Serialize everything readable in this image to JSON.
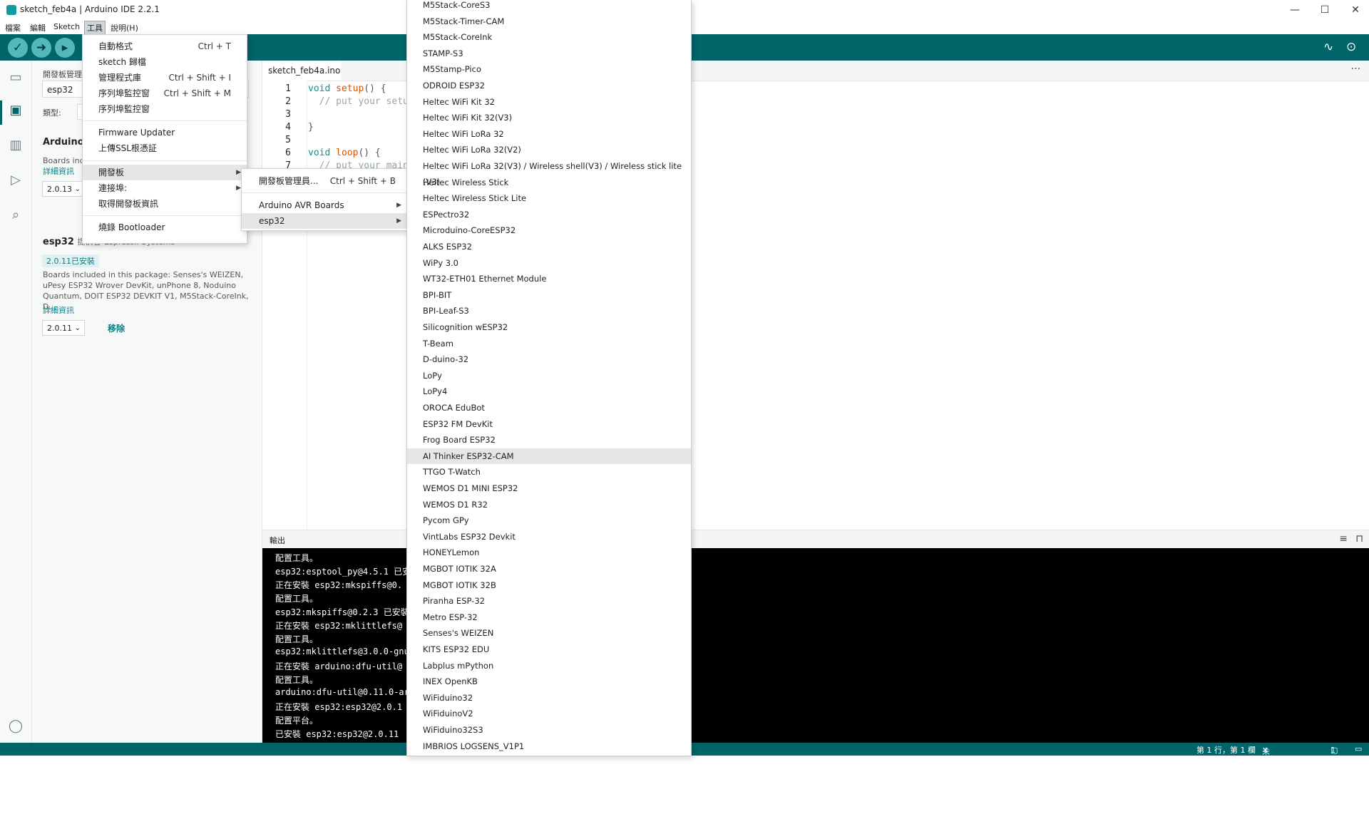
{
  "window": {
    "title": "sketch_feb4a | Arduino IDE 2.2.1",
    "minimize": "—",
    "maximize": "☐",
    "close": "✕"
  },
  "menubar": [
    "檔案",
    "編輯",
    "Sketch",
    "工具",
    "說明(H)"
  ],
  "side_panel": {
    "header": "開發板管理員",
    "search_value": "esp32",
    "type_label": "類型:",
    "boards": [
      {
        "name": "Arduino",
        "desc": "Boards inc",
        "link": "詳細資訊",
        "version": "2.0.13"
      },
      {
        "name": "esp32",
        "by": "提供者",
        "author": "Espressif Systems",
        "installed": "2.0.11已安裝",
        "desc": "Boards included in this package: Senses's WEIZEN, uPesy ESP32 Wrover DevKit, unPhone 8, Noduino Quantum, DOIT ESP32 DEVKIT V1, M5Stack-CoreInk, D...",
        "link": "詳細資訊",
        "version": "2.0.11",
        "remove": "移除"
      }
    ]
  },
  "editor": {
    "tab": "sketch_feb4a.ino",
    "line_numbers": [
      "1",
      "2",
      "3",
      "4",
      "5",
      "6",
      "7"
    ],
    "code": {
      "l1_kw": "void",
      "l1_fn": "setup",
      "l1_rest": "() {",
      "l2": "  // put your setup",
      "l4": "}",
      "l6_kw": "void",
      "l6_fn": "loop",
      "l6_rest": "() {",
      "l7": "  // put your main"
    }
  },
  "output": {
    "label": "輸出",
    "lines": [
      "配置工具。",
      "esp32:esptool_py@4.5.1 已安",
      "正在安裝 esp32:mkspiffs@0.",
      "配置工具。",
      "esp32:mkspiffs@0.2.3 已安裝",
      "正在安裝 esp32:mklittlefs@",
      "配置工具。",
      "esp32:mklittlefs@3.0.0-gnu",
      "正在安裝 arduino:dfu-util@",
      "配置工具。",
      "arduino:dfu-util@0.11.0-ar",
      "正在安裝 esp32:esp32@2.0.1",
      "配置平台。",
      "已安裝 esp32:esp32@2.0.11"
    ]
  },
  "status": {
    "position": "第 1 行，第 1 欄",
    "board": "未選取開發板",
    "notifications": "1"
  },
  "tools_menu": {
    "items": [
      {
        "label": "自動格式",
        "shortcut": "Ctrl + T"
      },
      {
        "label": "sketch 歸檔",
        "shortcut": ""
      },
      {
        "label": "管理程式庫",
        "shortcut": "Ctrl + Shift + I"
      },
      {
        "label": "序列埠監控窗",
        "shortcut": "Ctrl + Shift + M"
      },
      {
        "label": "序列埠監控窗",
        "shortcut": ""
      },
      {
        "label": "Firmware Updater",
        "shortcut": ""
      },
      {
        "label": "上傳SSL根憑証",
        "shortcut": ""
      },
      {
        "label": "開發板",
        "shortcut": ""
      },
      {
        "label": "連接埠:",
        "shortcut": ""
      },
      {
        "label": "取得開發板資訊",
        "shortcut": ""
      },
      {
        "label": "燒錄 Bootloader",
        "shortcut": ""
      }
    ]
  },
  "board_submenu": {
    "items": [
      {
        "label": "開發板管理員...",
        "shortcut": "Ctrl + Shift + B"
      },
      {
        "label": "Arduino AVR Boards",
        "shortcut": ""
      },
      {
        "label": "esp32",
        "shortcut": ""
      }
    ]
  },
  "esp32_boards": [
    "M5Stack-CoreS3",
    "M5Stack-Timer-CAM",
    "M5Stack-CoreInk",
    "STAMP-S3",
    "M5Stamp-Pico",
    "ODROID ESP32",
    "Heltec WiFi Kit 32",
    "Heltec WiFi Kit 32(V3)",
    "Heltec WiFi LoRa 32",
    "Heltec WiFi LoRa 32(V2)",
    "Heltec WiFi LoRa 32(V3) / Wireless shell(V3) / Wireless stick lite (V3)",
    "Heltec Wireless Stick",
    "Heltec Wireless Stick Lite",
    "ESPectro32",
    "Microduino-CoreESP32",
    "ALKS ESP32",
    "WiPy 3.0",
    "WT32-ETH01 Ethernet Module",
    "BPI-BIT",
    "BPI-Leaf-S3",
    "Silicognition wESP32",
    "T-Beam",
    "D-duino-32",
    "LoPy",
    "LoPy4",
    "OROCA EduBot",
    "ESP32 FM DevKit",
    "Frog Board ESP32",
    "AI Thinker ESP32-CAM",
    "TTGO T-Watch",
    "WEMOS D1 MINI ESP32",
    "WEMOS D1 R32",
    "Pycom GPy",
    "VintLabs ESP32 Devkit",
    "HONEYLemon",
    "MGBOT IOTIK 32A",
    "MGBOT IOTIK 32B",
    "Piranha ESP-32",
    "Metro ESP-32",
    "Senses's WEIZEN",
    "KITS ESP32 EDU",
    "Labplus mPython",
    "INEX OpenKB",
    "WiFiduino32",
    "WiFiduinoV2",
    "WiFiduino32S3",
    "IMBRIOS LOGSENS_V1P1"
  ],
  "esp32_boards_highlighted": "AI Thinker ESP32-CAM",
  "colors": {
    "teal": "#006468",
    "teal_light": "#54b7bc",
    "accent": "#0a7f84"
  }
}
